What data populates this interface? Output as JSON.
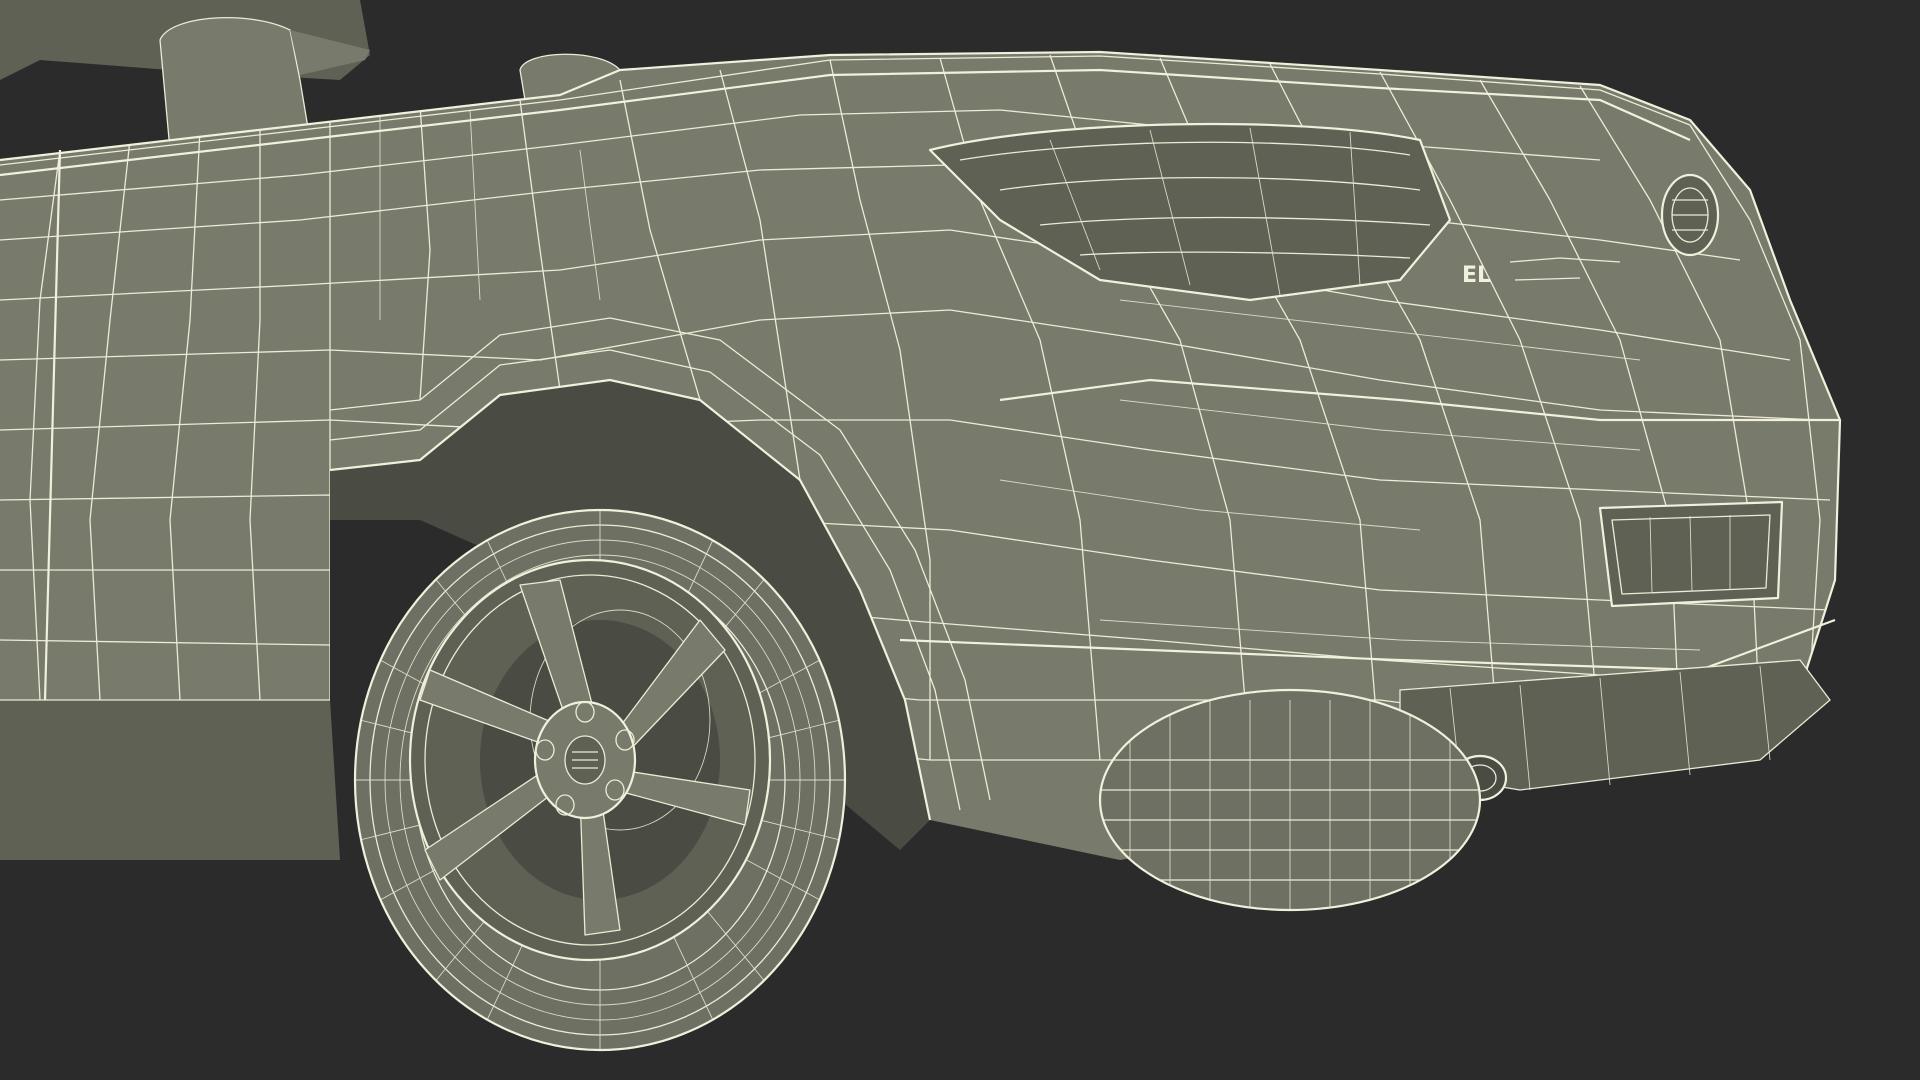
{
  "scene": {
    "background": "#2b2b2b",
    "body_color": "#787a6b",
    "wire_color": "#ecebd6",
    "subject": "wireframe-car-rear-quarter"
  },
  "badge": {
    "text": "EL"
  }
}
